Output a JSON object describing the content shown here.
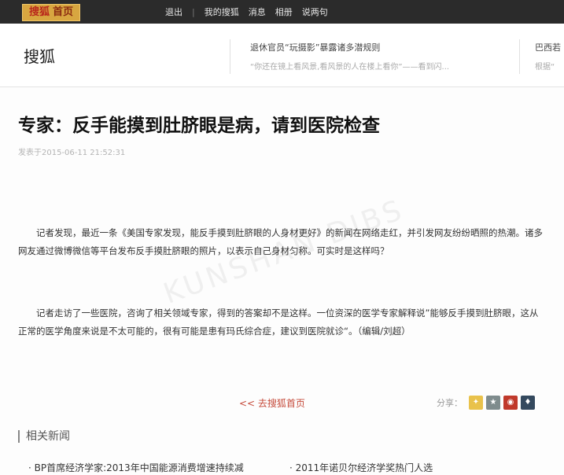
{
  "topbar": {
    "logo_brand": "搜狐",
    "logo_home": "首页",
    "nav": [
      "退出",
      "我的搜狐",
      "消息",
      "相册",
      "说两句"
    ],
    "separator": "|"
  },
  "header": {
    "brand": "搜狐",
    "headline_left": "退休官员“玩摄影”暴露诸多潜规则",
    "sub_left": "“你还在镜上看风景,看风景的人在楼上看你”——看到闪...",
    "headline_right": "巴西若",
    "sub_right": "根据“"
  },
  "article": {
    "title": "专家：反手能摸到肚脐眼是病，请到医院检查",
    "pubdate": "发表于2015-06-11 21:52:31",
    "para1": "记者发现，最近一条《美国专家发现，能反手摸到肚脐眼的人身材更好》的新闻在网络走红，并引发网友纷纷晒照的热潮。诸多网友通过微博微信等平台发布反手摸肚脐眼的照片，以表示自己身材匀称。可实时是这样吗？",
    "para2": "记者走访了一些医院，咨询了相关领域专家，得到的答案却不是这样。一位资深的医学专家解释说”能够反手摸到肚脐眼，这从正常的医学角度来说是不太可能的，很有可能是患有玛氏综合症，建议到医院就诊“。（编辑/刘超）",
    "watermark": "KUNSHAN DIBS"
  },
  "footer": {
    "back_link": "<< 去搜狐首页",
    "share_label": "分享：",
    "share_icons": [
      "tencent-weibo-icon",
      "qq-zone-icon",
      "weibo-icon",
      "renren-icon"
    ],
    "related_title": "相关新闻",
    "news": [
      "BP首席经济学家:2013年中国能源消费增速持续减",
      "2011年诺贝尔经济学奖热门人选"
    ]
  }
}
